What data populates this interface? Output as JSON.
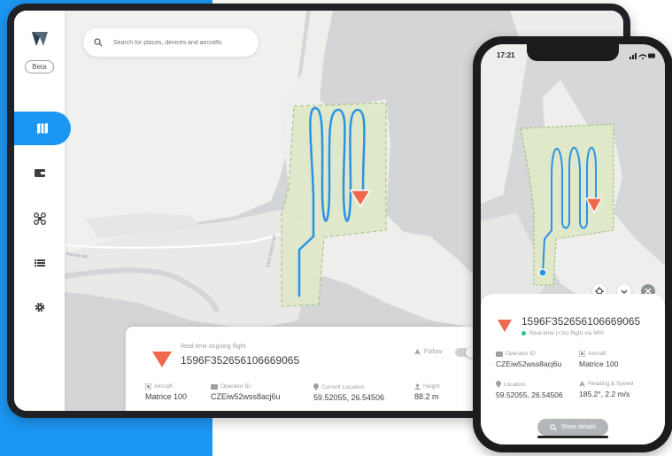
{
  "search": {
    "placeholder": "Search for places, devices and aircrafts"
  },
  "sidebar": {
    "beta_label": "Beta",
    "items": [
      {
        "icon": "map-icon",
        "active": true
      },
      {
        "icon": "wallet-icon",
        "active": false
      },
      {
        "icon": "drone-icon",
        "active": false
      },
      {
        "icon": "list-icon",
        "active": false
      },
      {
        "icon": "gear-icon",
        "active": false
      }
    ]
  },
  "map": {
    "road_label": "Ranna tee",
    "street_label": "Elva-Suitsu tee"
  },
  "flight_card": {
    "subtitle": "Real-time ongoing flight",
    "flight_id": "1596F352656106669065",
    "follow_label": "Follow",
    "fields": [
      {
        "label": "Aircraft",
        "value": "Matrice 100"
      },
      {
        "label": "Operator ID",
        "value": "CZEiw52wss8acj6u"
      },
      {
        "label": "Current Location",
        "value": "59.52055, 26.54506"
      },
      {
        "label": "Height",
        "value": "88.2 m"
      }
    ]
  },
  "phone": {
    "time": "17:21",
    "flight_id": "1596F352656106669065",
    "subtitle": "Real-time (<3s) flight via MRI",
    "fields": [
      {
        "label": "Operator ID",
        "value": "CZEiw52wss8acj6u"
      },
      {
        "label": "Aircraft",
        "value": "Matrice 100"
      },
      {
        "label": "Location",
        "value": "59.52055, 26.54506"
      },
      {
        "label": "Heading & Speed",
        "value": "185.2°, 2.2 m/s"
      }
    ],
    "details_button": "Show details"
  },
  "colors": {
    "accent": "#1c96f3",
    "area_fill": "#dfe8c9",
    "flight_path": "#2a93e6",
    "aircraft_marker": "#ef6a4c",
    "live_dot": "#27c4a0"
  }
}
